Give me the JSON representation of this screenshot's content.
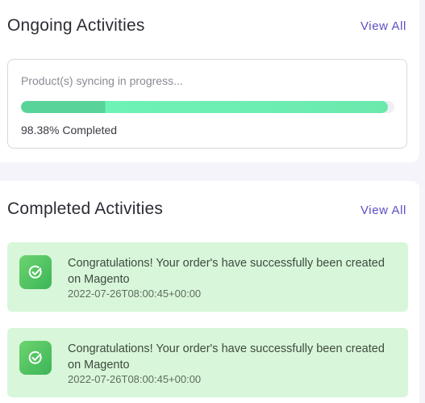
{
  "ongoing": {
    "title": "Ongoing Activities",
    "view_all": "View All",
    "progress": {
      "label": "Product(s) syncing in progress...",
      "percent": 98.38,
      "status_text": "98.38% Completed"
    }
  },
  "completed": {
    "title": "Completed Activities",
    "view_all": "View All",
    "items": [
      {
        "icon": "check-circle-icon",
        "message": "Congratulations! Your order's have successfully been created on Magento",
        "timestamp": "2022-07-26T08:00:45+00:00"
      },
      {
        "icon": "check-circle-icon",
        "message": "Congratulations! Your order's have successfully been created on Magento",
        "timestamp": "2022-07-26T08:00:45+00:00"
      }
    ]
  },
  "colors": {
    "accent": "#5b4fc4",
    "progress_fill": "#6ae9ad",
    "success_bg": "#d8f6d9",
    "success_icon": "#3db558"
  }
}
